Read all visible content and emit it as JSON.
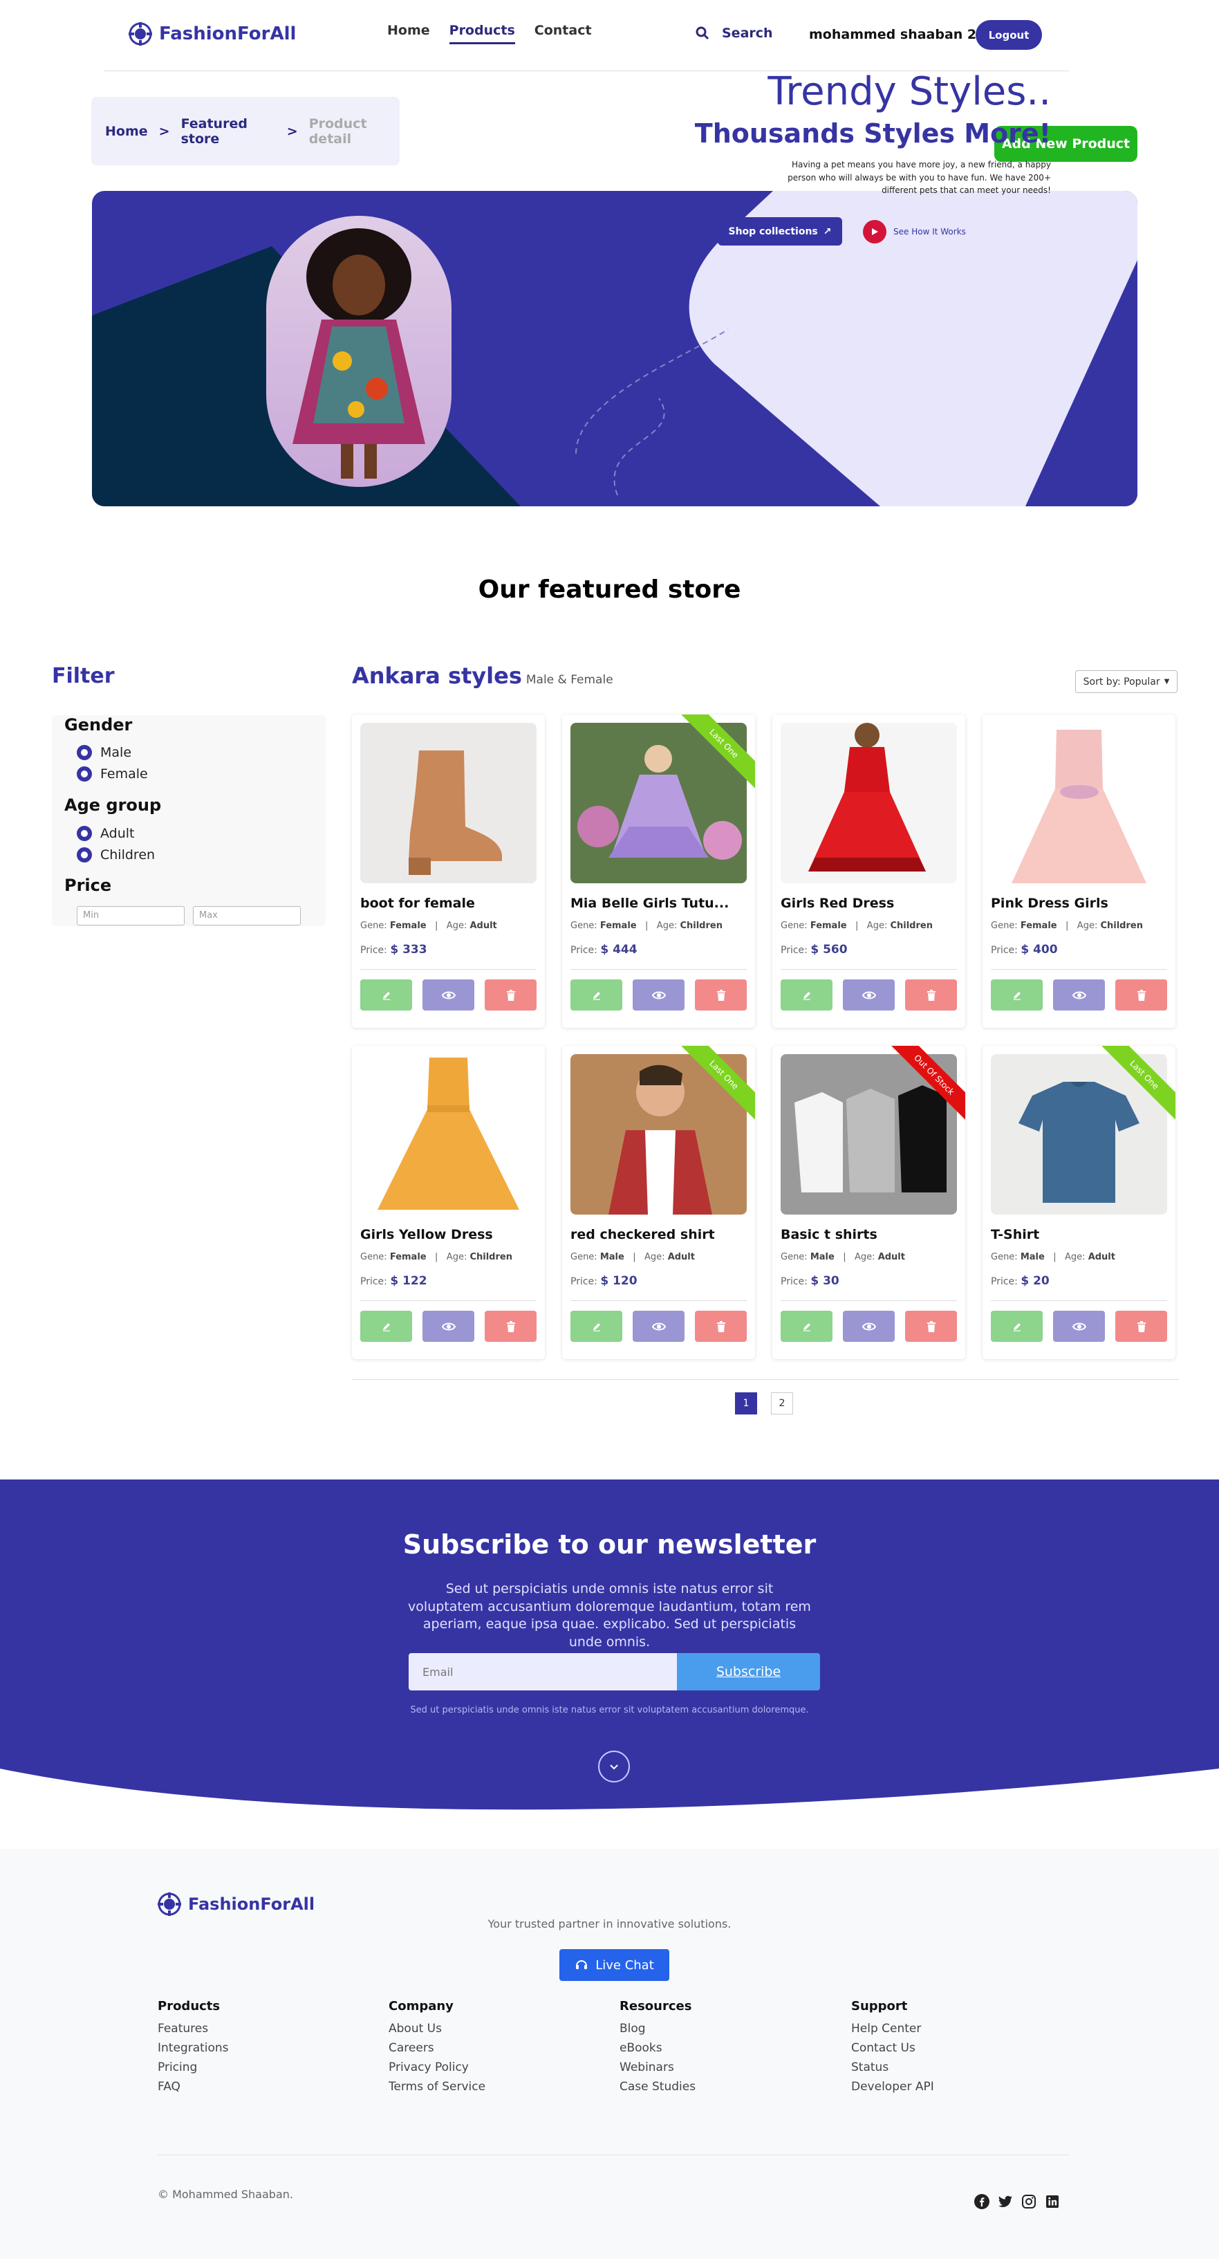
{
  "header": {
    "brand": "FashionForAll",
    "nav": [
      "Home",
      "Products",
      "Contact"
    ],
    "search_label": "Search",
    "user": "mohammed shaaban 29",
    "logout": "Logout"
  },
  "breadcrumb": [
    "Home",
    ">",
    "Featured store",
    ">",
    "Product detail"
  ],
  "add_product": "Add New Product",
  "hero": {
    "title": "Trendy Styles..",
    "subtitle": "Thousands Styles More!",
    "text": "Having a pet means you have more joy, a new friend, a happy person who will always be with you to have fun. We have 200+ different pets that can meet your needs!",
    "shop_btn": "Shop collections",
    "see_how": "See How It Works"
  },
  "section_title": "Our featured store",
  "filter": {
    "title": "Filter",
    "gender_label": "Gender",
    "gender_options": [
      "Male",
      "Female"
    ],
    "age_label": "Age group",
    "age_options": [
      "Adult",
      "Children"
    ],
    "price_label": "Price",
    "min_placeholder": "Min",
    "max_placeholder": "Max"
  },
  "products_header": {
    "title": "Ankara styles",
    "subtitle": "Male & Female",
    "sort": "Sort by: Popular"
  },
  "labels": {
    "gene": "Gene:",
    "age": "Age:",
    "price": "Price:"
  },
  "products": [
    {
      "name": "boot for female",
      "gene": "Female",
      "age": "Adult",
      "price": "$ 333",
      "ribbon": ""
    },
    {
      "name": "Mia Belle Girls Tutu...",
      "gene": "Female",
      "age": "Children",
      "price": "$ 444",
      "ribbon": "Last One"
    },
    {
      "name": "Girls Red Dress",
      "gene": "Female",
      "age": "Children",
      "price": "$ 560",
      "ribbon": ""
    },
    {
      "name": "Pink Dress Girls",
      "gene": "Female",
      "age": "Children",
      "price": "$ 400",
      "ribbon": ""
    },
    {
      "name": "Girls Yellow Dress",
      "gene": "Female",
      "age": "Children",
      "price": "$ 122",
      "ribbon": ""
    },
    {
      "name": "red checkered shirt",
      "gene": "Male",
      "age": "Adult",
      "price": "$ 120",
      "ribbon": "Last One"
    },
    {
      "name": "Basic t shirts",
      "gene": "Male",
      "age": "Adult",
      "price": "$ 30",
      "ribbon": "Out Of Stock"
    },
    {
      "name": "T-Shirt",
      "gene": "Male",
      "age": "Adult",
      "price": "$ 20",
      "ribbon": "Last One"
    }
  ],
  "pagination": [
    "1",
    "2"
  ],
  "newsletter": {
    "title": "Subscribe to our newsletter",
    "text": "Sed ut perspiciatis unde omnis iste natus error sit voluptatem accusantium doloremque laudantium, totam rem aperiam, eaque ipsa quae. explicabo. Sed ut perspiciatis unde omnis.",
    "email_placeholder": "Email",
    "subscribe": "Subscribe",
    "small": "Sed ut perspiciatis unde omnis iste natus error sit voluptatem accusantium doloremque."
  },
  "footer": {
    "brand": "FashionForAll",
    "tagline": "Your trusted partner in innovative solutions.",
    "live_chat": "Live Chat",
    "columns": [
      {
        "title": "Products",
        "links": [
          "Features",
          "Integrations",
          "Pricing",
          "FAQ"
        ]
      },
      {
        "title": "Company",
        "links": [
          "About Us",
          "Careers",
          "Privacy Policy",
          "Terms of Service"
        ]
      },
      {
        "title": "Resources",
        "links": [
          "Blog",
          "eBooks",
          "Webinars",
          "Case Studies"
        ]
      },
      {
        "title": "Support",
        "links": [
          "Help Center",
          "Contact Us",
          "Status",
          "Developer API"
        ]
      }
    ],
    "copyright": "© Mohammed Shaaban."
  },
  "colors": {
    "brand": "#3634a3",
    "green": "#21b621",
    "ribbon_green": "#7ed321",
    "ribbon_red": "#e01010"
  }
}
